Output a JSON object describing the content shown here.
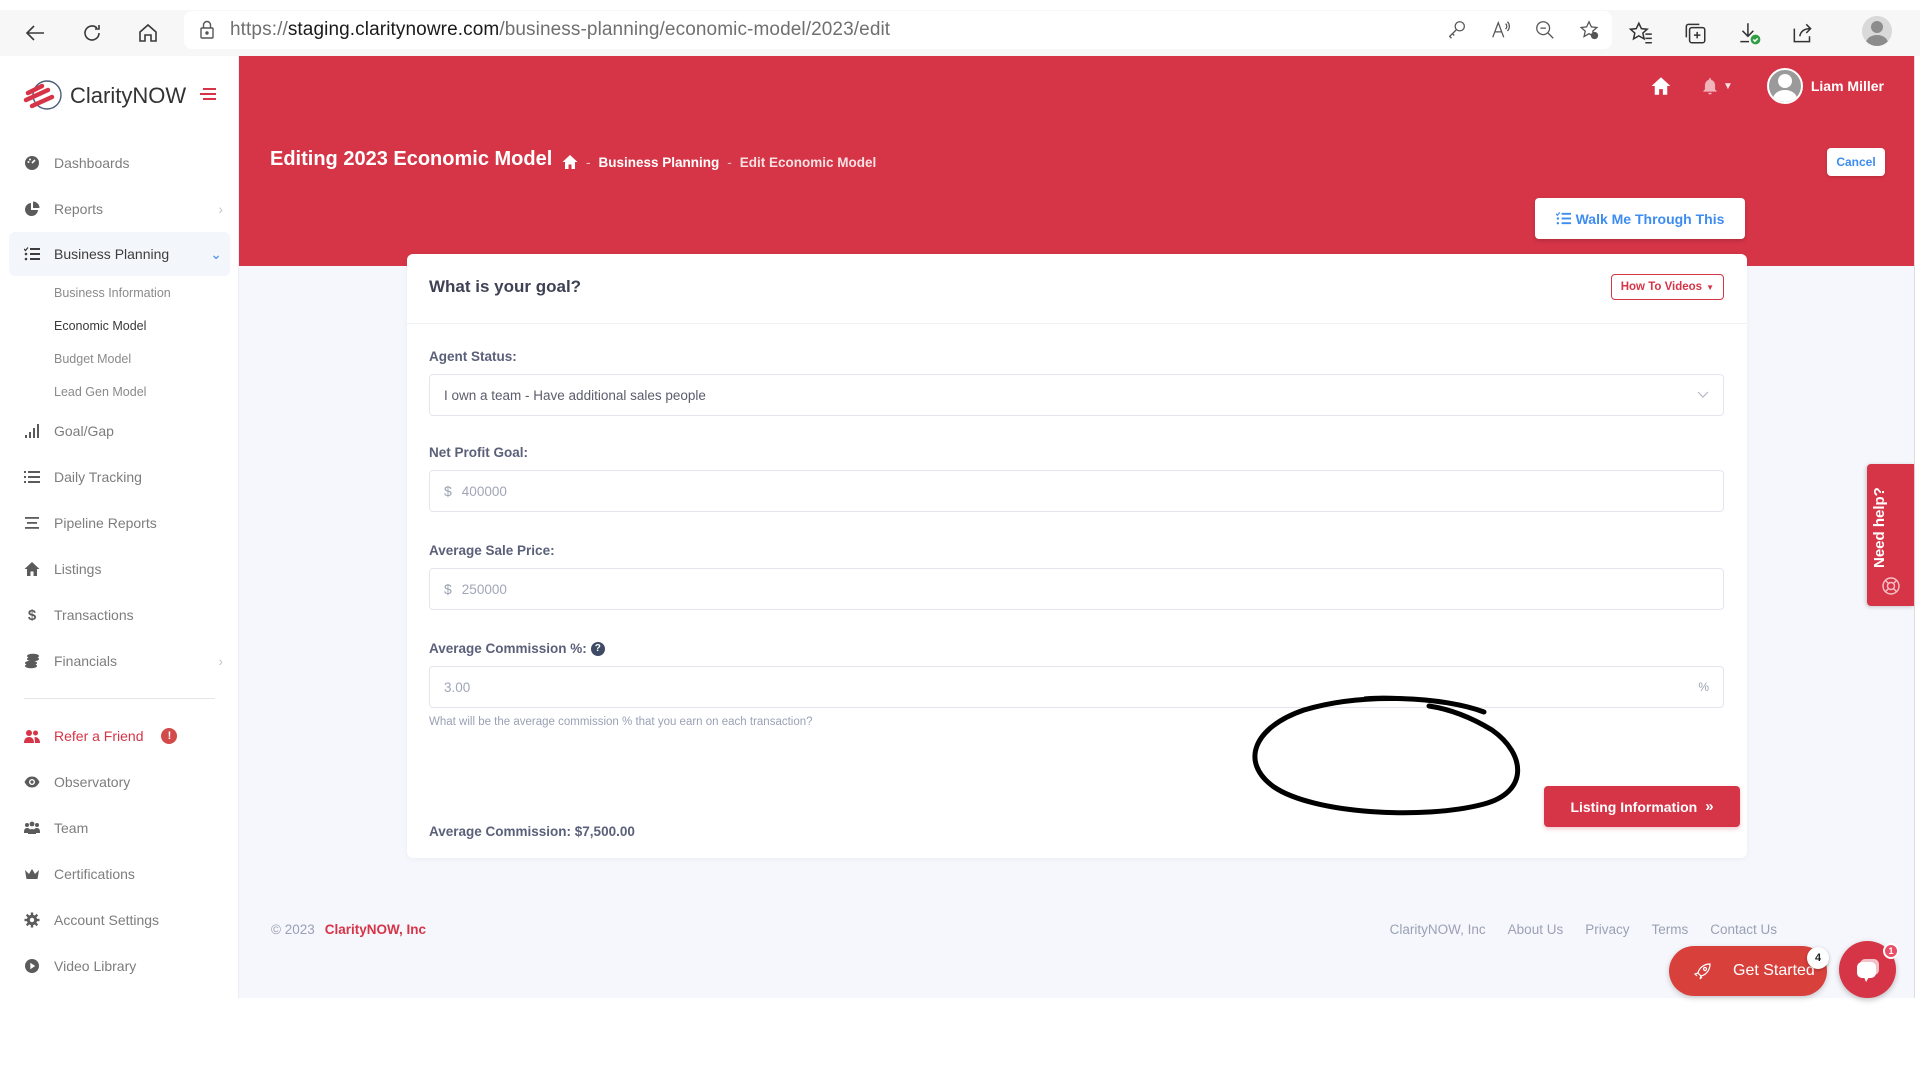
{
  "browser": {
    "url_prefix": "https://",
    "url_host": "staging.claritynowre.com",
    "url_path": "/business-planning/economic-model/2023/edit"
  },
  "sidebar": {
    "logo_text": "ClarityNOW",
    "items_top": [
      {
        "label": "Dashboards",
        "icon": "dashboard-icon"
      },
      {
        "label": "Reports",
        "icon": "pie-chart-icon",
        "has_chevron": true
      }
    ],
    "active_item": {
      "label": "Business Planning",
      "icon": "tasks-list-icon"
    },
    "submenu": [
      {
        "label": "Business Information",
        "current": false
      },
      {
        "label": "Economic Model",
        "current": true
      },
      {
        "label": "Budget Model",
        "current": false
      },
      {
        "label": "Lead Gen Model",
        "current": false
      }
    ],
    "items_mid": [
      {
        "label": "Goal/Gap",
        "icon": "signal-bars-icon"
      },
      {
        "label": "Daily Tracking",
        "icon": "list-icon"
      },
      {
        "label": "Pipeline Reports",
        "icon": "lines-icon"
      },
      {
        "label": "Listings",
        "icon": "home-icon"
      },
      {
        "label": "Transactions",
        "icon": "dollar-icon"
      },
      {
        "label": "Financials",
        "icon": "coins-icon",
        "has_chevron": true
      }
    ],
    "refer": {
      "label": "Refer a Friend",
      "badge": "!"
    },
    "items_bottom": [
      {
        "label": "Observatory",
        "icon": "eye-icon"
      },
      {
        "label": "Team",
        "icon": "users-icon"
      },
      {
        "label": "Certifications",
        "icon": "crown-icon"
      },
      {
        "label": "Account Settings",
        "icon": "gear-icon"
      },
      {
        "label": "Video Library",
        "icon": "play-circle-icon"
      }
    ]
  },
  "header": {
    "user_name": "Liam Miller",
    "page_title": "Editing 2023 Economic Model",
    "breadcrumb": [
      "Business Planning",
      "Edit Economic Model"
    ],
    "breadcrumb_sep": "-",
    "cancel_label": "Cancel",
    "walk_label": "Walk Me Through This"
  },
  "card": {
    "title": "What is your goal?",
    "howto_label": "How To Videos",
    "fields": {
      "agent_status": {
        "label": "Agent Status:",
        "value": "I own a team - Have additional sales people"
      },
      "net_profit": {
        "label": "Net Profit Goal:",
        "prefix": "$",
        "value": "400000"
      },
      "avg_sale": {
        "label": "Average Sale Price:",
        "prefix": "$",
        "value": "250000"
      },
      "avg_comm_pct": {
        "label": "Average Commission %:",
        "value": "3.00",
        "suffix": "%",
        "help": "What will be the average commission % that you earn on each transaction?",
        "info": "?"
      }
    },
    "avg_commission": "Average Commission: $7,500.00",
    "next_label": "Listing Information",
    "next_glyph": "»"
  },
  "need_help": "Need help?",
  "footer": {
    "copyright": "© 2023",
    "brand": "ClarityNOW, Inc",
    "links": [
      "ClarityNOW, Inc",
      "About Us",
      "Privacy",
      "Terms",
      "Contact Us"
    ]
  },
  "widgets": {
    "get_started": "Get Started",
    "get_started_badge": "4",
    "chat_badge": "1"
  },
  "colors": {
    "brand_red": "#d53547",
    "link_blue": "#3d8cf0"
  }
}
